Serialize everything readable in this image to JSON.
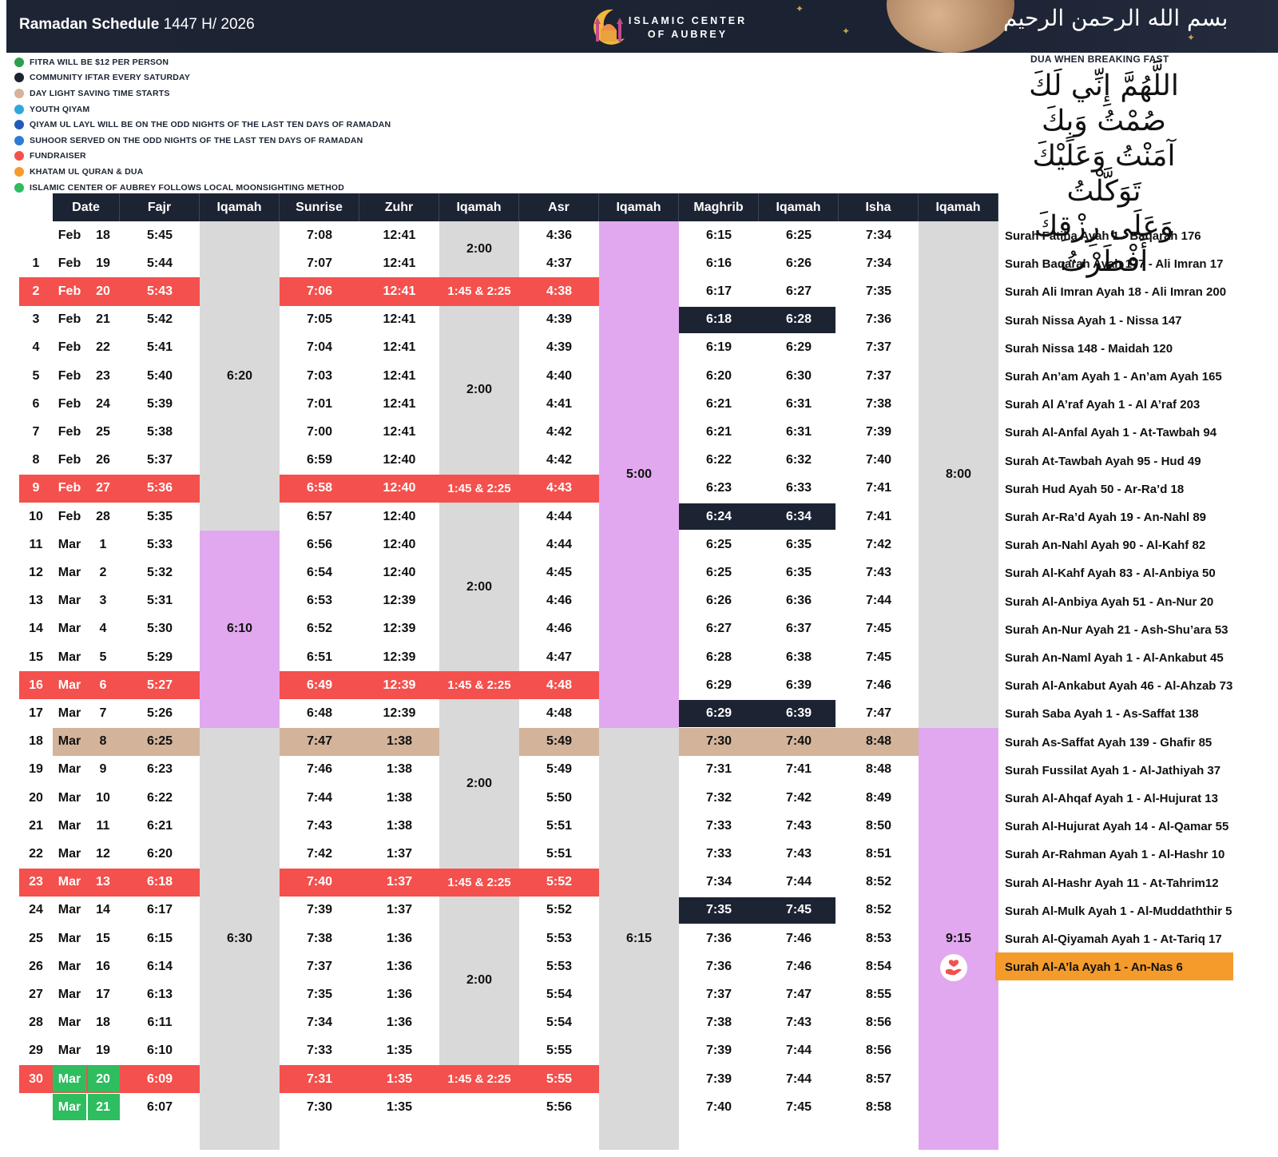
{
  "header": {
    "title": "Ramadan Schedule",
    "title_year": "1447 H/ 2026",
    "center_name_line1": "ISLAMIC CENTER",
    "center_name_line2": "OF AUBREY",
    "bismillah": "بسم الله الرحمن الرحيم"
  },
  "legend": [
    {
      "text": "FITRA WILL BE $12 PER PERSON",
      "color": "#2e9e4f",
      "icon": "money-icon"
    },
    {
      "text": "COMMUNITY IFTAR EVERY SATURDAY",
      "color": "#1c2333",
      "icon": "cutlery-icon"
    },
    {
      "text": "DAY LIGHT SAVING TIME STARTS",
      "color": "#d3b49a",
      "icon": "dot-icon"
    },
    {
      "text": "YOUTH QIYAM",
      "color": "#2ea8dc",
      "icon": "youth-icon"
    },
    {
      "text": "QIYAM UL LAYL WILL BE ON THE ODD NIGHTS OF THE LAST TEN DAYS OF RAMADAN",
      "color": "#1f5bbd",
      "icon": "prayer-icon"
    },
    {
      "text": "SUHOOR SERVED ON THE ODD NIGHTS OF THE LAST TEN DAYS OF RAMADAN",
      "color": "#2c7cd6",
      "icon": "cutlery-icon"
    },
    {
      "text": "FUNDRAISER",
      "color": "#f4504d",
      "icon": "fundraiser-icon"
    },
    {
      "text": "KHATAM UL QURAN & DUA",
      "color": "#f49b2b",
      "icon": "dot-icon"
    },
    {
      "text": "ISLAMIC CENTER OF AUBREY FOLLOWS LOCAL MOONSIGHTING METHOD",
      "color": "#2ebd5f",
      "icon": "moon-icon"
    }
  ],
  "dua": {
    "title": "DUA WHEN BREAKING FAST",
    "lines": [
      "اللَّهُمَّ إِنِّي لَكَ صُمْتُ وَبِكَ",
      "آمَنْتُ وَعَلَيْكَ تَوَكَّلْتُ",
      "وَعَلَى رِزْقِكَ أَفْطَرْتُ"
    ]
  },
  "columns": [
    "Date",
    "Fajr",
    "Iqamah",
    "Sunrise",
    "Zuhr",
    "Iqamah",
    "Asr",
    "Iqamah",
    "Maghrib",
    "Iqamah",
    "Isha",
    "Iqamah"
  ],
  "rows": [
    {
      "day": "",
      "month": "Feb",
      "date": "18",
      "fajr": "5:45",
      "sunrise": "7:08",
      "zuhr": "12:41",
      "asr": "4:36",
      "maghrib": "6:15",
      "maghrib_iqamah": "6:25",
      "isha": "7:34",
      "surah": "Surah Fatiha Ayah 1 - Baqarah 176"
    },
    {
      "day": "1",
      "month": "Feb",
      "date": "19",
      "fajr": "5:44",
      "sunrise": "7:07",
      "zuhr": "12:41",
      "asr": "4:37",
      "maghrib": "6:16",
      "maghrib_iqamah": "6:26",
      "isha": "7:34",
      "surah": "Surah Baqarah Ayah 177 - Ali Imran 17"
    },
    {
      "day": "2",
      "month": "Feb",
      "date": "20",
      "fajr": "5:43",
      "sunrise": "7:06",
      "zuhr": "12:41",
      "zuhr_iqamah": "1:45 & 2:25",
      "asr": "4:38",
      "maghrib": "6:17",
      "maghrib_iqamah": "6:27",
      "isha": "7:35",
      "surah": "Surah Ali Imran Ayah 18  - Ali Imran 200",
      "hl": "red"
    },
    {
      "day": "3",
      "month": "Feb",
      "date": "21",
      "fajr": "5:42",
      "sunrise": "7:05",
      "zuhr": "12:41",
      "asr": "4:39",
      "maghrib": "6:18",
      "maghrib_iqamah": "6:28",
      "isha": "7:36",
      "surah": "Surah Nissa Ayah 1  - Nissa 147",
      "mg": "dark"
    },
    {
      "day": "4",
      "month": "Feb",
      "date": "22",
      "fajr": "5:41",
      "sunrise": "7:04",
      "zuhr": "12:41",
      "asr": "4:39",
      "maghrib": "6:19",
      "maghrib_iqamah": "6:29",
      "isha": "7:37",
      "surah": "Surah Nissa 148 - Maidah 120"
    },
    {
      "day": "5",
      "month": "Feb",
      "date": "23",
      "fajr": "5:40",
      "sunrise": "7:03",
      "zuhr": "12:41",
      "asr": "4:40",
      "maghrib": "6:20",
      "maghrib_iqamah": "6:30",
      "isha": "7:37",
      "surah": "Surah An’am Ayah 1 - An’am Ayah 165"
    },
    {
      "day": "6",
      "month": "Feb",
      "date": "24",
      "fajr": "5:39",
      "sunrise": "7:01",
      "zuhr": "12:41",
      "asr": "4:41",
      "maghrib": "6:21",
      "maghrib_iqamah": "6:31",
      "isha": "7:38",
      "surah": "Surah Al A’raf Ayah 1 - Al A’raf 203"
    },
    {
      "day": "7",
      "month": "Feb",
      "date": "25",
      "fajr": "5:38",
      "sunrise": "7:00",
      "zuhr": "12:41",
      "asr": "4:42",
      "maghrib": "6:21",
      "maghrib_iqamah": "6:31",
      "isha": "7:39",
      "surah": "Surah Al-Anfal Ayah 1 - At-Tawbah 94"
    },
    {
      "day": "8",
      "month": "Feb",
      "date": "26",
      "fajr": "5:37",
      "sunrise": "6:59",
      "zuhr": "12:40",
      "asr": "4:42",
      "maghrib": "6:22",
      "maghrib_iqamah": "6:32",
      "isha": "7:40",
      "surah": "Surah At-Tawbah Ayah 95 - Hud 49"
    },
    {
      "day": "9",
      "month": "Feb",
      "date": "27",
      "fajr": "5:36",
      "sunrise": "6:58",
      "zuhr": "12:40",
      "zuhr_iqamah": "1:45 & 2:25",
      "asr": "4:43",
      "maghrib": "6:23",
      "maghrib_iqamah": "6:33",
      "isha": "7:41",
      "surah": "Surah Hud Ayah 50 - Ar-Ra’d 18",
      "hl": "red"
    },
    {
      "day": "10",
      "month": "Feb",
      "date": "28",
      "fajr": "5:35",
      "sunrise": "6:57",
      "zuhr": "12:40",
      "asr": "4:44",
      "maghrib": "6:24",
      "maghrib_iqamah": "6:34",
      "isha": "7:41",
      "surah": "Surah Ar-Ra’d Ayah 19 - An-Nahl 89",
      "mg": "dark"
    },
    {
      "day": "11",
      "month": "Mar",
      "date": "1",
      "fajr": "5:33",
      "sunrise": "6:56",
      "zuhr": "12:40",
      "asr": "4:44",
      "maghrib": "6:25",
      "maghrib_iqamah": "6:35",
      "isha": "7:42",
      "surah": "Surah An-Nahl Ayah 90 - Al-Kahf 82"
    },
    {
      "day": "12",
      "month": "Mar",
      "date": "2",
      "fajr": "5:32",
      "sunrise": "6:54",
      "zuhr": "12:40",
      "asr": "4:45",
      "maghrib": "6:25",
      "maghrib_iqamah": "6:35",
      "isha": "7:43",
      "surah": "Surah Al-Kahf Ayah 83 - Al-Anbiya 50"
    },
    {
      "day": "13",
      "month": "Mar",
      "date": "3",
      "fajr": "5:31",
      "sunrise": "6:53",
      "zuhr": "12:39",
      "asr": "4:46",
      "maghrib": "6:26",
      "maghrib_iqamah": "6:36",
      "isha": "7:44",
      "surah": "Surah Al-Anbiya Ayah 51 - An-Nur 20"
    },
    {
      "day": "14",
      "month": "Mar",
      "date": "4",
      "fajr": "5:30",
      "sunrise": "6:52",
      "zuhr": "12:39",
      "asr": "4:46",
      "maghrib": "6:27",
      "maghrib_iqamah": "6:37",
      "isha": "7:45",
      "surah": "Surah An-Nur Ayah 21 - Ash-Shu’ara 53"
    },
    {
      "day": "15",
      "month": "Mar",
      "date": "5",
      "fajr": "5:29",
      "sunrise": "6:51",
      "zuhr": "12:39",
      "asr": "4:47",
      "maghrib": "6:28",
      "maghrib_iqamah": "6:38",
      "isha": "7:45",
      "surah": "Surah An-Naml Ayah 1 - Al-Ankabut 45"
    },
    {
      "day": "16",
      "month": "Mar",
      "date": "6",
      "fajr": "5:27",
      "sunrise": "6:49",
      "zuhr": "12:39",
      "zuhr_iqamah": "1:45 & 2:25",
      "asr": "4:48",
      "maghrib": "6:29",
      "maghrib_iqamah": "6:39",
      "isha": "7:46",
      "surah": "Surah Al-Ankabut Ayah 46 - Al-Ahzab 73",
      "hl": "red"
    },
    {
      "day": "17",
      "month": "Mar",
      "date": "7",
      "fajr": "5:26",
      "sunrise": "6:48",
      "zuhr": "12:39",
      "asr": "4:48",
      "maghrib": "6:29",
      "maghrib_iqamah": "6:39",
      "isha": "7:47",
      "surah": "Surah Saba Ayah 1 - As-Saffat 138",
      "mg": "dark"
    },
    {
      "day": "18",
      "month": "Mar",
      "date": "8",
      "fajr": "6:25",
      "sunrise": "7:47",
      "zuhr": "1:38",
      "asr": "5:49",
      "maghrib": "7:30",
      "maghrib_iqamah": "7:40",
      "isha": "8:48",
      "surah": "Surah As-Saffat Ayah 139 - Ghafir 85",
      "hl": "tan"
    },
    {
      "day": "19",
      "month": "Mar",
      "date": "9",
      "fajr": "6:23",
      "sunrise": "7:46",
      "zuhr": "1:38",
      "asr": "5:49",
      "maghrib": "7:31",
      "maghrib_iqamah": "7:41",
      "isha": "8:48",
      "surah": "Surah Fussilat Ayah 1 - Al-Jathiyah 37"
    },
    {
      "day": "20",
      "month": "Mar",
      "date": "10",
      "fajr": "6:22",
      "sunrise": "7:44",
      "zuhr": "1:38",
      "asr": "5:50",
      "maghrib": "7:32",
      "maghrib_iqamah": "7:42",
      "isha": "8:49",
      "surah": "Surah Al-Ahqaf Ayah 1 - Al-Hujurat 13"
    },
    {
      "day": "21",
      "month": "Mar",
      "date": "11",
      "fajr": "6:21",
      "sunrise": "7:43",
      "zuhr": "1:38",
      "asr": "5:51",
      "maghrib": "7:33",
      "maghrib_iqamah": "7:43",
      "isha": "8:50",
      "surah": "Surah Al-Hujurat Ayah 14 - Al-Qamar 55"
    },
    {
      "day": "22",
      "month": "Mar",
      "date": "12",
      "fajr": "6:20",
      "sunrise": "7:42",
      "zuhr": "1:37",
      "asr": "5:51",
      "maghrib": "7:33",
      "maghrib_iqamah": "7:43",
      "isha": "8:51",
      "surah": "Surah Ar-Rahman Ayah 1 - Al-Hashr 10"
    },
    {
      "day": "23",
      "month": "Mar",
      "date": "13",
      "fajr": "6:18",
      "sunrise": "7:40",
      "zuhr": "1:37",
      "zuhr_iqamah": "1:45 & 2:25",
      "asr": "5:52",
      "maghrib": "7:34",
      "maghrib_iqamah": "7:44",
      "isha": "8:52",
      "surah": "Surah Al-Hashr Ayah 11 - At-Tahrim12",
      "hl": "red"
    },
    {
      "day": "24",
      "month": "Mar",
      "date": "14",
      "fajr": "6:17",
      "sunrise": "7:39",
      "zuhr": "1:37",
      "asr": "5:52",
      "maghrib": "7:35",
      "maghrib_iqamah": "7:45",
      "isha": "8:52",
      "surah": "Surah Al-Mulk Ayah 1 - Al-Muddaththir 5",
      "mg": "dark"
    },
    {
      "day": "25",
      "month": "Mar",
      "date": "15",
      "fajr": "6:15",
      "sunrise": "7:38",
      "zuhr": "1:36",
      "asr": "5:53",
      "maghrib": "7:36",
      "maghrib_iqamah": "7:46",
      "isha": "8:53",
      "surah": "Surah Al-Qiyamah Ayah 1 - At-Tariq 17"
    },
    {
      "day": "26",
      "month": "Mar",
      "date": "16",
      "fajr": "6:14",
      "sunrise": "7:37",
      "zuhr": "1:36",
      "asr": "5:53",
      "maghrib": "7:36",
      "maghrib_iqamah": "7:46",
      "isha": "8:54",
      "surah": "Surah Al-A’la Ayah 1 - An-Nas 6",
      "khatam": true
    },
    {
      "day": "27",
      "month": "Mar",
      "date": "17",
      "fajr": "6:13",
      "sunrise": "7:35",
      "zuhr": "1:36",
      "asr": "5:54",
      "maghrib": "7:37",
      "maghrib_iqamah": "7:47",
      "isha": "8:55",
      "surah": ""
    },
    {
      "day": "28",
      "month": "Mar",
      "date": "18",
      "fajr": "6:11",
      "sunrise": "7:34",
      "zuhr": "1:36",
      "asr": "5:54",
      "maghrib": "7:38",
      "maghrib_iqamah": "7:43",
      "isha": "8:56",
      "surah": ""
    },
    {
      "day": "29",
      "month": "Mar",
      "date": "19",
      "fajr": "6:10",
      "sunrise": "7:33",
      "zuhr": "1:35",
      "asr": "5:55",
      "maghrib": "7:39",
      "maghrib_iqamah": "7:44",
      "isha": "8:56",
      "surah": ""
    },
    {
      "day": "30",
      "month": "Mar",
      "date": "20",
      "fajr": "6:09",
      "sunrise": "7:31",
      "zuhr": "1:35",
      "zuhr_iqamah": "1:45 & 2:25",
      "asr": "5:55",
      "maghrib": "7:39",
      "maghrib_iqamah": "7:44",
      "isha": "8:57",
      "surah": "",
      "hl": "red",
      "moon": true
    },
    {
      "day": "",
      "month": "Mar",
      "date": "21",
      "fajr": "6:07",
      "sunrise": "7:30",
      "zuhr": "1:35",
      "asr": "5:56",
      "maghrib": "7:40",
      "maghrib_iqamah": "7:45",
      "isha": "8:58",
      "surah": "",
      "moon": true
    }
  ],
  "fajr_iqamah_groups": [
    {
      "start": 0,
      "end": 10,
      "value": "6:20",
      "color": "#d9d9d9"
    },
    {
      "start": 11,
      "end": 17,
      "value": "6:10",
      "color": "#e2a8ef"
    },
    {
      "start": 18,
      "end": 32,
      "value": "6:30",
      "color": "#d9d9d9"
    }
  ],
  "zuhr_iqamah_groups": [
    {
      "start": 0,
      "end": 1,
      "value": "2:00",
      "color": "#d9d9d9"
    },
    {
      "start": 3,
      "end": 8,
      "value": "2:00",
      "color": "#d9d9d9"
    },
    {
      "start": 10,
      "end": 15,
      "value": "2:00",
      "color": "#d9d9d9"
    },
    {
      "start": 17,
      "end": 22,
      "value": "2:00",
      "color": "#d9d9d9"
    },
    {
      "start": 24,
      "end": 29,
      "value": "2:00",
      "color": "#d9d9d9"
    }
  ],
  "asr_iqamah_groups": [
    {
      "start": 0,
      "end": 17,
      "value": "5:00",
      "color": "#e2a8ef"
    },
    {
      "start": 18,
      "end": 32,
      "value": "6:15",
      "color": "#d9d9d9"
    }
  ],
  "isha_iqamah_groups": [
    {
      "start": 0,
      "end": 17,
      "value": "8:00",
      "color": "#d9d9d9"
    },
    {
      "start": 18,
      "end": 32,
      "value": "9:15",
      "color": "#e2a8ef"
    }
  ],
  "colors": {
    "red": "#f4504d",
    "tan": "#d3b49a",
    "dark": "#1c2333",
    "green": "#2ebd5f",
    "grey": "#d9d9d9",
    "purple": "#e2a8ef",
    "orange": "#f49b2b"
  },
  "fundraiser_icon": "fundraiser-icon"
}
